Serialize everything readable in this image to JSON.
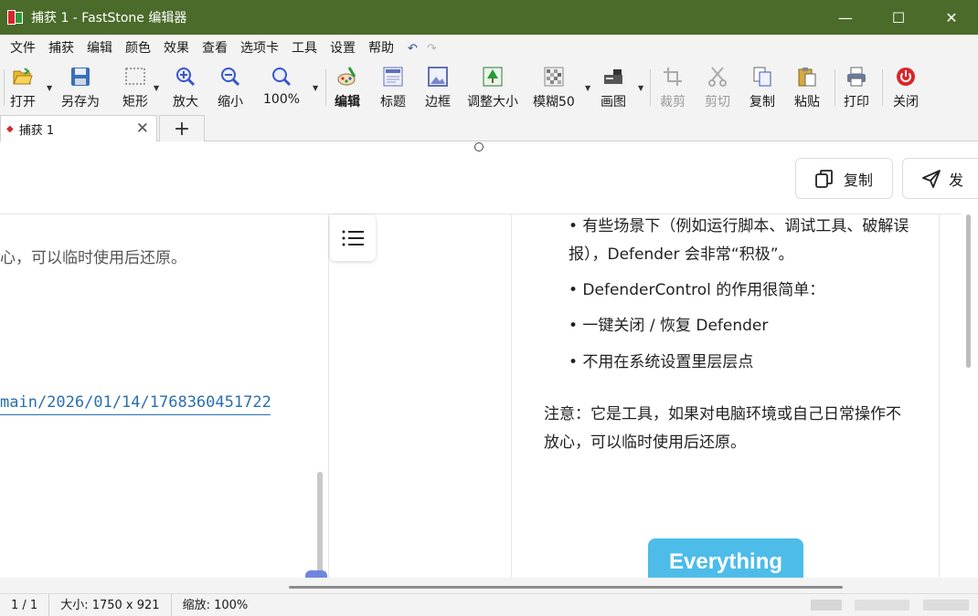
{
  "window": {
    "title": "捕获 1 - FastStone 编辑器",
    "controls": {
      "minimize": "—",
      "maximize": "☐",
      "close": "✕"
    },
    "title_bar_color": "#4b6b2a"
  },
  "menu": {
    "items": [
      "文件",
      "捕获",
      "编辑",
      "颜色",
      "效果",
      "查看",
      "选项卡",
      "工具",
      "设置",
      "帮助"
    ],
    "undo": "↶",
    "redo": "↷"
  },
  "toolbar": {
    "open": "打开",
    "save_as": "另存为",
    "rect": "矩形",
    "zoom_in": "放大",
    "zoom_out": "缩小",
    "zoom_level": "100%",
    "edit": "编辑",
    "caption": "标题",
    "border": "边框",
    "resize": "调整大小",
    "blur": "模糊50",
    "draw": "画图",
    "crop": "裁剪",
    "cut": "剪切",
    "copy": "复制",
    "paste": "粘贴",
    "print": "打印",
    "close": "关闭"
  },
  "tabs": {
    "active_label": "捕获 1",
    "close_glyph": "✕",
    "new_tab_glyph": "+"
  },
  "canvas": {
    "copy_button": "复制",
    "send_button": "发",
    "left_text": "心，可以临时使用后还原。",
    "left_link": "main/2026/01/14/1768360451722-",
    "bullets": [
      "• 有些场景下（例如运行脚本、调试工具、破解误报），Defender 会非常“积极”。",
      "• DefenderControl 的作用很简单：",
      "• 一键关闭 / 恢复 Defender",
      "• 不用在系统设置里层层点"
    ],
    "note": "注意：它是工具，如果对电脑环境或自己日常操作不放心，可以临时使用后还原。",
    "everything_label": "Everything",
    "everything_color": "#4dbce9"
  },
  "status": {
    "page": "1 / 1",
    "size": "大小: 1750 x 921",
    "zoom": "缩放: 100%"
  }
}
